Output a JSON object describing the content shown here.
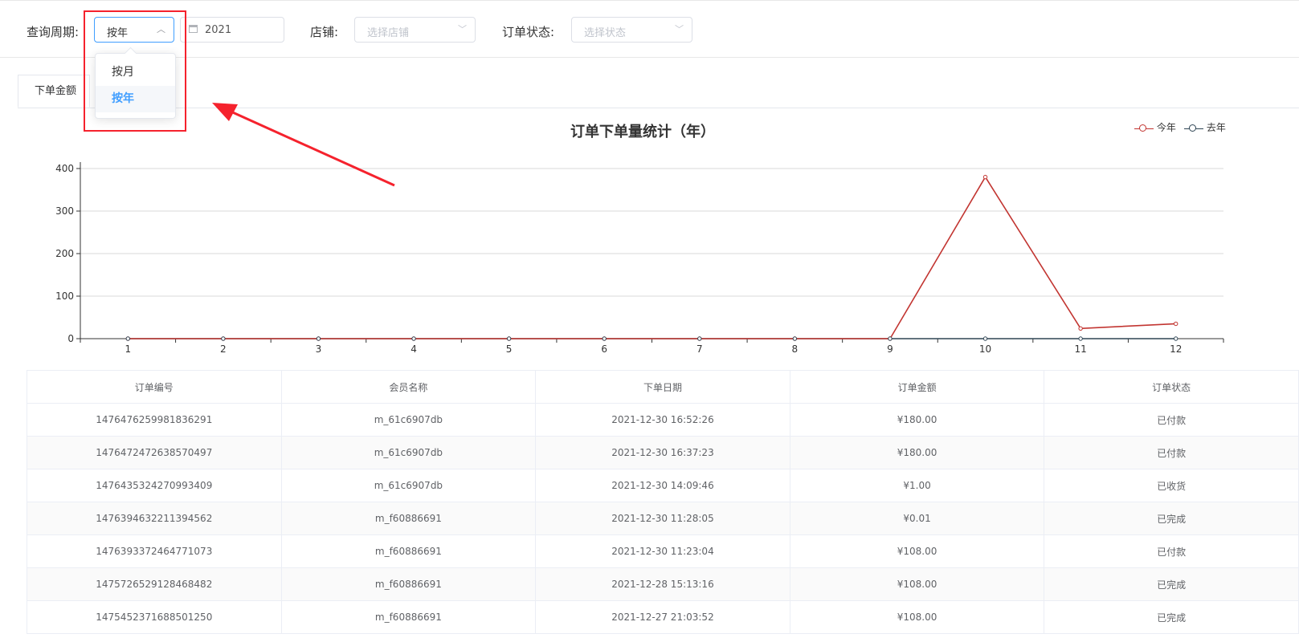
{
  "filters": {
    "period_label": "查询周期:",
    "period_value": "按年",
    "date_value": "2021",
    "shop_label": "店铺:",
    "shop_placeholder": "选择店铺",
    "status_label": "订单状态:",
    "status_placeholder": "选择状态"
  },
  "period_dropdown": {
    "options": [
      "按月",
      "按年"
    ],
    "selected": "按年"
  },
  "tabs": [
    {
      "label": "下单金额"
    }
  ],
  "chart_data": {
    "type": "line",
    "title": "订单下单量统计（年）",
    "categories": [
      "1",
      "2",
      "3",
      "4",
      "5",
      "6",
      "7",
      "8",
      "9",
      "10",
      "11",
      "12"
    ],
    "ylim": [
      0,
      400
    ],
    "yticks": [
      "0",
      "100",
      "200",
      "300",
      "400"
    ],
    "legend_position": "top-right",
    "series": [
      {
        "name": "今年",
        "color": "#c23531",
        "values": [
          0,
          0,
          0,
          0,
          0,
          0,
          0,
          0,
          0,
          380,
          24,
          35
        ]
      },
      {
        "name": "去年",
        "color": "#2f4554",
        "values": [
          0,
          0,
          0,
          0,
          0,
          0,
          0,
          0,
          0,
          0,
          0,
          0
        ]
      }
    ],
    "grid": true
  },
  "table": {
    "columns": [
      "订单编号",
      "会员名称",
      "下单日期",
      "订单金额",
      "订单状态"
    ],
    "rows": [
      [
        "1476476259981836291",
        "m_61c6907db",
        "2021-12-30 16:52:26",
        "¥180.00",
        "已付款"
      ],
      [
        "1476472472638570497",
        "m_61c6907db",
        "2021-12-30 16:37:23",
        "¥180.00",
        "已付款"
      ],
      [
        "1476435324270993409",
        "m_61c6907db",
        "2021-12-30 14:09:46",
        "¥1.00",
        "已收货"
      ],
      [
        "1476394632211394562",
        "m_f60886691",
        "2021-12-30 11:28:05",
        "¥0.01",
        "已完成"
      ],
      [
        "1476393372464771073",
        "m_f60886691",
        "2021-12-30 11:23:04",
        "¥108.00",
        "已付款"
      ],
      [
        "1475726529128468482",
        "m_f60886691",
        "2021-12-28 15:13:16",
        "¥108.00",
        "已完成"
      ],
      [
        "1475452371688501250",
        "m_f60886691",
        "2021-12-27 21:03:52",
        "¥108.00",
        "已完成"
      ]
    ]
  },
  "annotation": {
    "box_color": "#f5222d",
    "arrow_color": "#f5222d"
  }
}
